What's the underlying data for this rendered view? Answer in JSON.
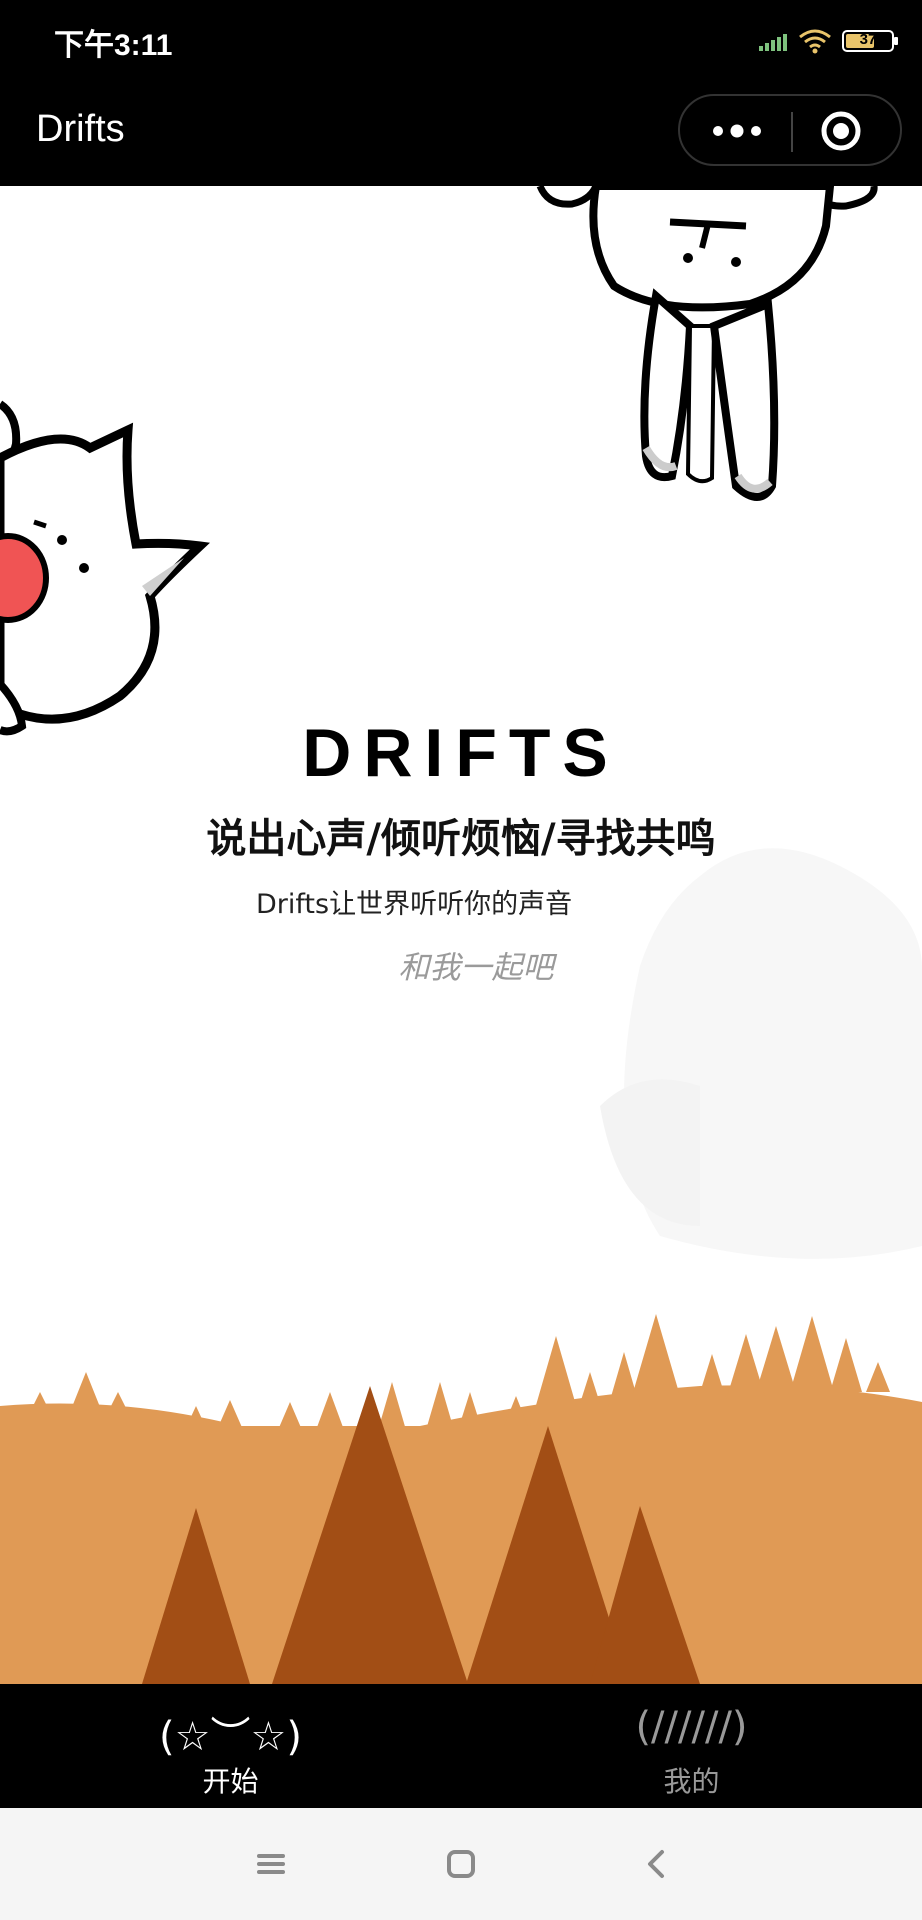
{
  "status_bar": {
    "time": "下午3:11",
    "battery_level": "37",
    "icons": [
      "signal-icon",
      "wifi-icon",
      "battery-icon"
    ]
  },
  "nav": {
    "title": "Drifts",
    "icons": [
      "more-icon",
      "target-icon"
    ]
  },
  "hero": {
    "logo": "DRIFTS",
    "slogan": "说出心声/倾听烦恼/寻找共鸣",
    "subline": "Drifts让世界听听你的声音",
    "invite": "和我一起吧"
  },
  "tabs": [
    {
      "face": "(☆︶☆)",
      "label": "开始",
      "active": true
    },
    {
      "face": "(//////)",
      "label": "我的",
      "active": false
    }
  ],
  "system_nav": [
    "menu-icon",
    "home-icon",
    "back-icon"
  ],
  "colors": {
    "bar_background": "#000000",
    "forest_light": "#e09a55",
    "forest_dark": "#a24e15",
    "tab_active": "#ffffff",
    "tab_inactive": "#999999",
    "invite_text": "#9a9a9a",
    "blush": "#f05454"
  }
}
